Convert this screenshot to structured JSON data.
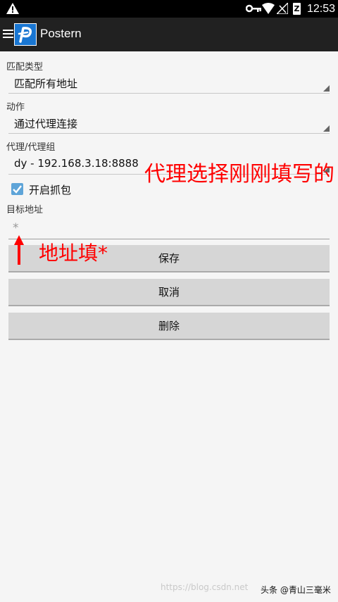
{
  "status_bar": {
    "time": "12:53",
    "battery_glyph": "Z"
  },
  "app": {
    "title": "Postern"
  },
  "form": {
    "match_type_label": "匹配类型",
    "match_type_value": "匹配所有地址",
    "action_label": "动作",
    "action_value": "通过代理连接",
    "proxy_label": "代理/代理组",
    "proxy_value": "dy - 192.168.3.18:8888",
    "capture_label": "开启抓包",
    "capture_checked": true,
    "target_label": "目标地址",
    "target_value": "*"
  },
  "buttons": {
    "save": "保存",
    "cancel": "取消",
    "delete": "删除"
  },
  "annotations": {
    "proxy_note": "代理选择刚刚填写的",
    "address_note": "地址填*",
    "color": "#ff0000"
  },
  "footer": {
    "watermark": "https://blog.csdn.net",
    "badge": "头条 @青山三毫米"
  },
  "colors": {
    "app_bar": "#212121",
    "status_bar": "#000000",
    "accent": "#5ea4d8",
    "logo": "#1976d2"
  }
}
